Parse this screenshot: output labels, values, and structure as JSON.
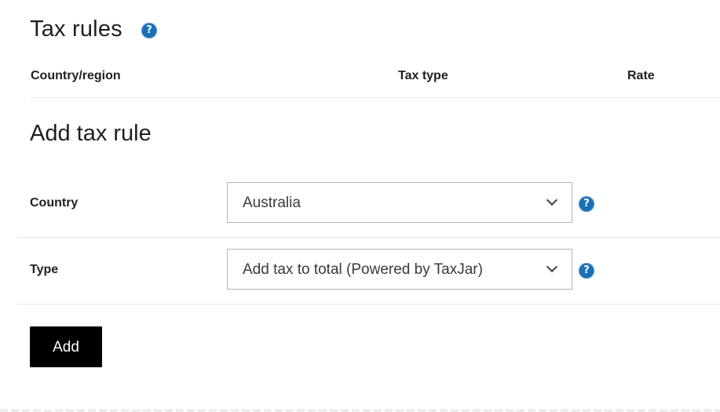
{
  "tax_rules": {
    "title": "Tax rules",
    "help_icon": "question-mark",
    "columns": [
      "Country/region",
      "Tax type",
      "Rate"
    ]
  },
  "add_tax_rule": {
    "title": "Add tax rule",
    "country": {
      "label": "Country",
      "selected": "Australia",
      "help_icon": "question-mark"
    },
    "type": {
      "label": "Type",
      "selected": "Add tax to total (Powered by TaxJar)",
      "help_icon": "question-mark"
    },
    "add_button_label": "Add"
  },
  "colors": {
    "accent_help": "#1a6fb5",
    "button_bg": "#000000",
    "button_text": "#ffffff"
  }
}
